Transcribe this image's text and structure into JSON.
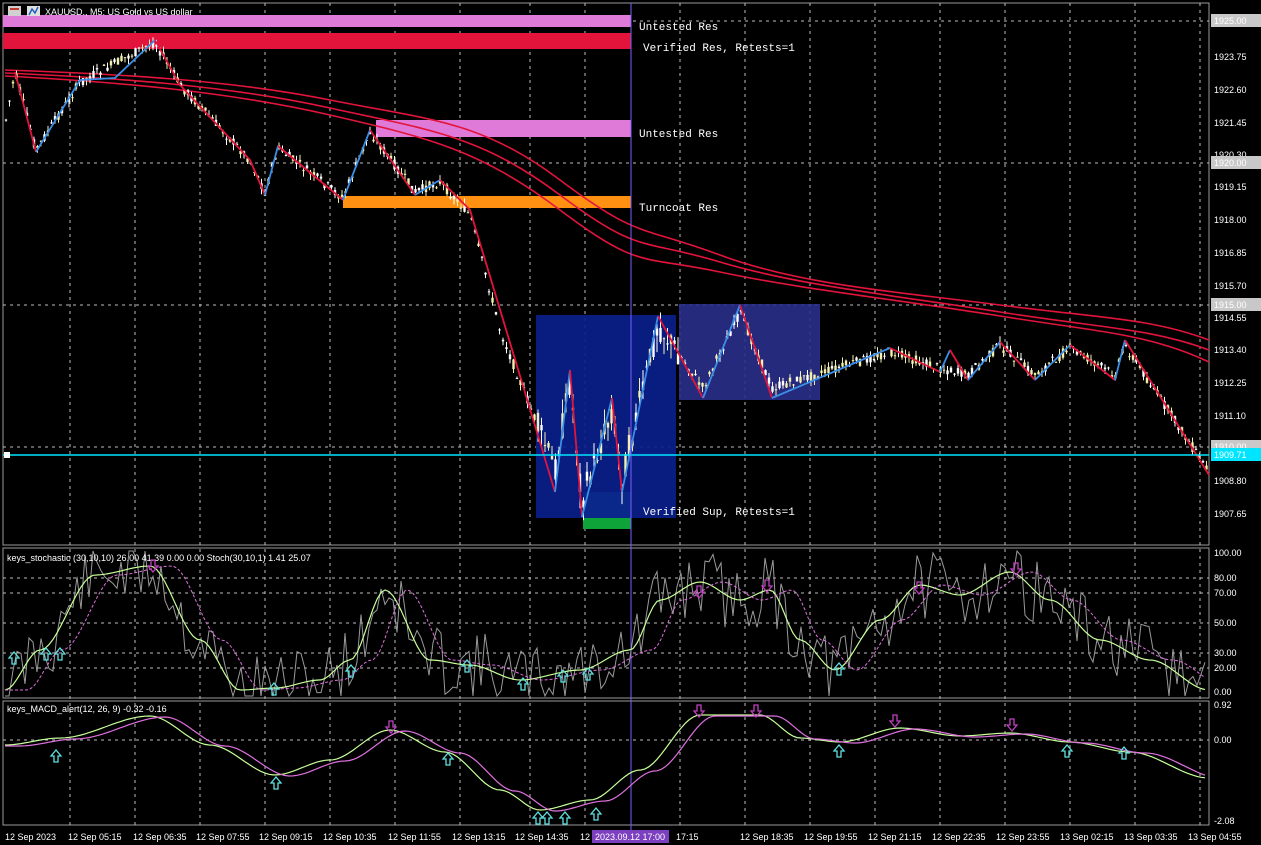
{
  "window": {
    "title": "XAUUSD., M5:  US Gold vs US dollar",
    "colors": {
      "background": "#000000",
      "up_candle": "#f2efb0",
      "down_candle": "#ffffff",
      "grid": "#9a9a9a"
    }
  },
  "zones": [
    {
      "label": "Untested Res",
      "color": "#e07ad8"
    },
    {
      "label": "Verified Res, Retests=1",
      "color": "#e3143c"
    },
    {
      "label": "Untested Res",
      "color": "#e07ad8"
    },
    {
      "label": "Turncoat Res",
      "color": "#ff9011"
    },
    {
      "label": "Verified Sup, Retests=1",
      "color": "#118e8e"
    }
  ],
  "price_axis": {
    "labels": [
      "1925.00",
      "1923.75",
      "1922.60",
      "1921.45",
      "1920.30",
      "1920.00",
      "1919.15",
      "1918.00",
      "1916.85",
      "1915.70",
      "1915.00",
      "1914.55",
      "1913.40",
      "1912.25",
      "1911.10",
      "1910.00",
      "1909.71",
      "1908.80",
      "1907.65"
    ],
    "current_price": "1909.71",
    "current_color": "#00e5ff"
  },
  "stochastic": {
    "title": "keys_stochastic (30,10,10) 26.00 41.39 0.00 0.00 Stoch(30,10,1) 1.41 25.07",
    "levels": [
      "100.00",
      "80.00",
      "70.00",
      "50.00",
      "30.00",
      "20.00",
      "0.00"
    ]
  },
  "macd": {
    "title": "keys_MACD_alert(12, 26, 9) -0.32 -0.16",
    "levels": [
      "0.92",
      "0.00",
      "-2.08"
    ]
  },
  "time_axis": {
    "labels": [
      "12 Sep 2023",
      "12 Sep 05:15",
      "12 Sep 06:35",
      "12 Sep 07:55",
      "12 Sep 09:15",
      "12 Sep 10:35",
      "12 Sep 11:55",
      "12 Sep 13:15",
      "12 Sep 14:35",
      "12",
      "17:15",
      "12 Sep 18:35",
      "12 Sep 19:55",
      "12 Sep 21:15",
      "12 Sep 22:35",
      "12 Sep 23:55",
      "13 Sep 02:15",
      "13 Sep 03:35",
      "13 Sep 04:55"
    ],
    "cursor_label": "2023.09.12 17:00"
  }
}
